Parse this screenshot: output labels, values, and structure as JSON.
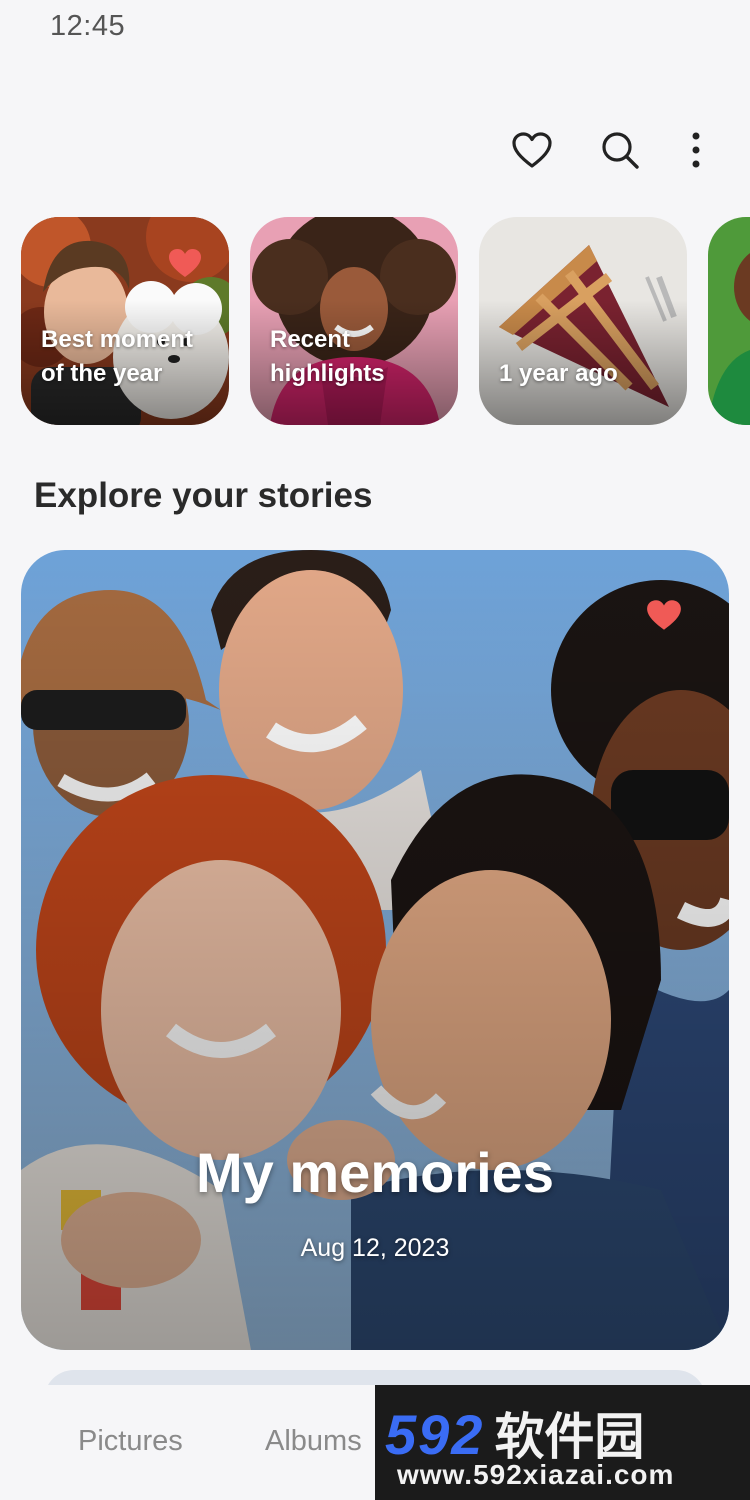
{
  "status_bar": {
    "time": "12:45"
  },
  "header": {
    "icons": [
      "heart-outline-icon",
      "search-icon",
      "more-vertical-icon"
    ]
  },
  "highlights": [
    {
      "label": "Best moment\nof the year",
      "favorite": true,
      "image": "boy-with-white-dog"
    },
    {
      "label": "Recent\nhighlights",
      "favorite": false,
      "image": "woman-curly-hair-pink"
    },
    {
      "label": "1 year ago",
      "favorite": false,
      "image": "slice-of-pie"
    },
    {
      "label": "",
      "favorite": false,
      "image": "person-green-background"
    }
  ],
  "section": {
    "title": "Explore your stories"
  },
  "story": {
    "title": "My memories",
    "date": "Aug 12,  2023",
    "favorite": true,
    "image": "group-of-friends-selfie"
  },
  "bottom_nav": {
    "tabs": [
      {
        "label": "Pictures"
      },
      {
        "label": "Albums"
      }
    ]
  },
  "watermark": {
    "number": "592",
    "name": "软件园",
    "url": "www.592xiazai.com"
  },
  "colors": {
    "background": "#f6f6f8",
    "favorite_heart": "#f05a56",
    "watermark_blue": "#3a6cf4"
  }
}
